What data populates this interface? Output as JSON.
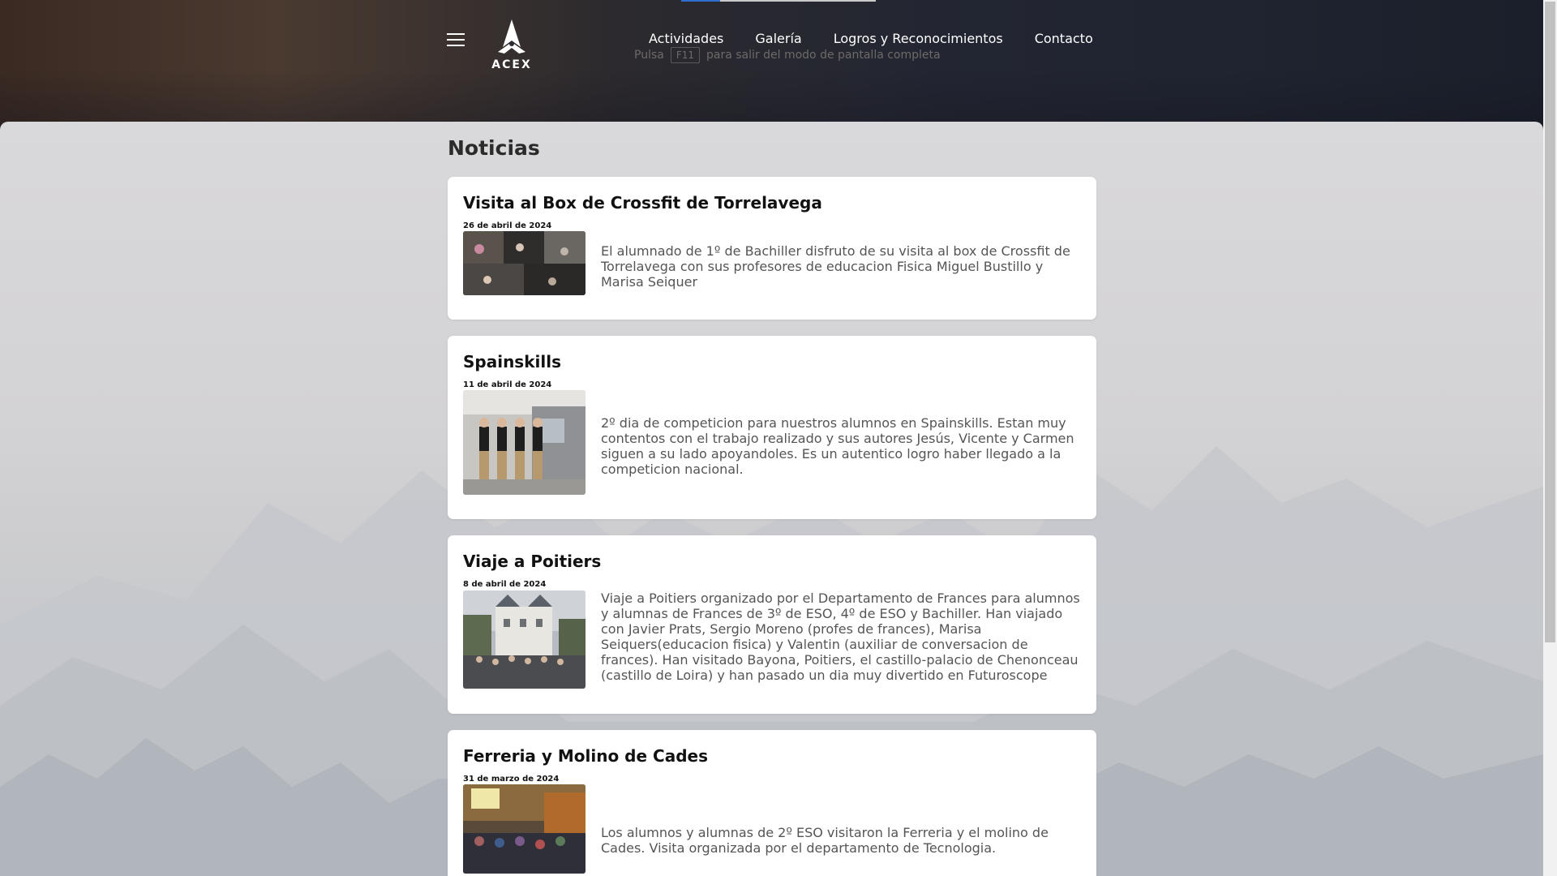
{
  "header": {
    "logo_text": "ACEX",
    "nav": [
      "Actividades",
      "Galería",
      "Logros y Reconocimientos",
      "Contacto"
    ],
    "fullscreen_hint": {
      "before": "Pulsa",
      "key": "F11",
      "after": "para salir del modo de pantalla completa"
    }
  },
  "main": {
    "title": "Noticias",
    "news": [
      {
        "title": "Visita al Box de Crossfit de Torrelavega",
        "date": "26 de abril de 2024",
        "text": "El alumnado de 1º de Bachiller disfruto de su visita al box de Crossfit de Torrelavega con sus profesores de educacion Fisica Miguel Bustillo y Marisa Seiquer"
      },
      {
        "title": "Spainskills",
        "date": "11 de abril de 2024",
        "text": "2º dia de competicion para nuestros alumnos en Spainskills. Estan muy contentos con el trabajo realizado y sus autores Jesús, Vicente y Carmen siguen a su lado apoyandoles. Es un autentico logro haber llegado a la competicion nacional."
      },
      {
        "title": "Viaje a Poitiers",
        "date": "8 de abril de 2024",
        "text": "Viaje a Poitiers organizado por el Departamento de Frances para alumnos y alumnas de Frances de 3º de ESO, 4º de ESO y Bachiller. Han viajado con Javier Prats, Sergio Moreno (profes de frances), Marisa Seiquers(educacion fisica) y Valentin (auxiliar de conversacion de frances). Han visitado Bayona, Poitiers, el castillo-palacio de Chenonceau (castillo de Loira) y han pasado un dia muy divertido en Futuroscope"
      },
      {
        "title": "Ferreria y Molino de Cades",
        "date": "31 de marzo de 2024",
        "text": "Los alumnos y alumnas de 2º ESO visitaron la Ferreria y el molino de Cades. Visita organizada por el departamento de Tecnologia."
      }
    ]
  },
  "colors": {
    "card_bg": "#ffffff",
    "text_body": "#555555",
    "nav_text": "#ffffff"
  }
}
